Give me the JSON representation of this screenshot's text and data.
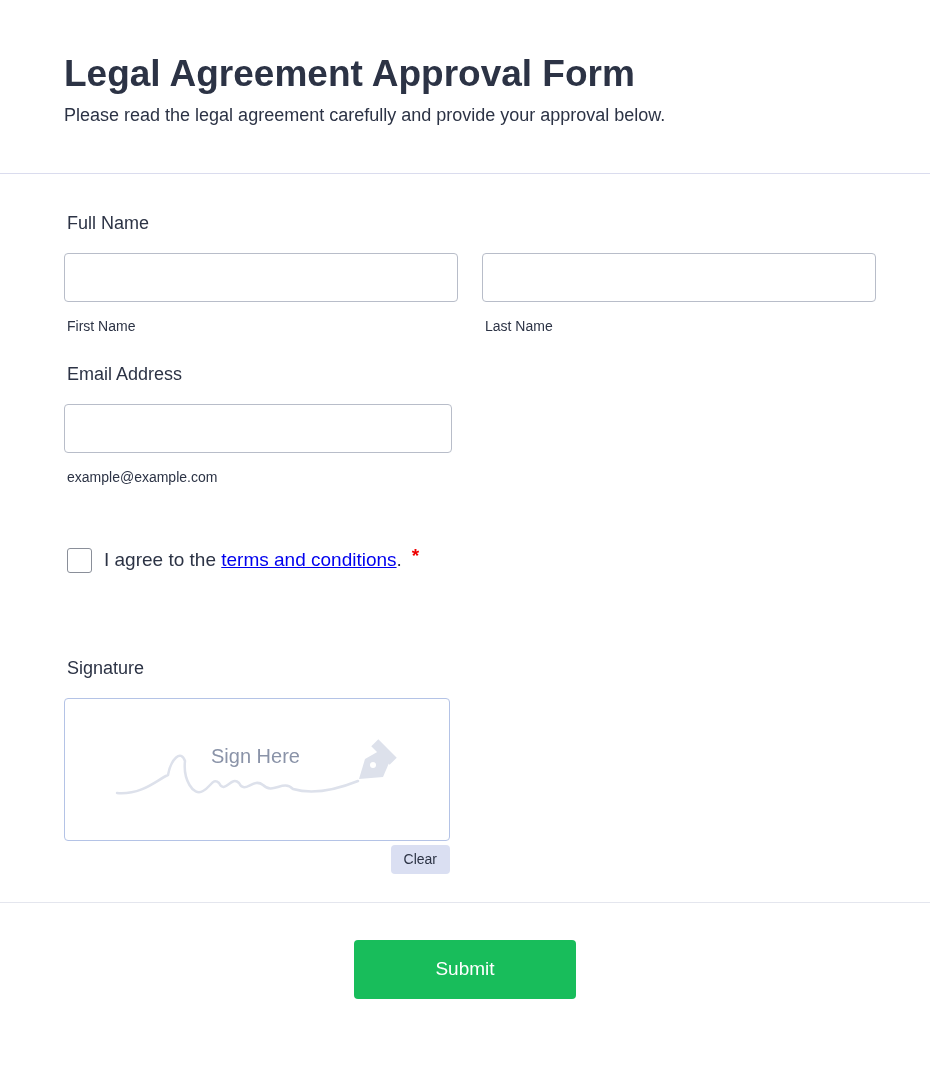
{
  "header": {
    "title": "Legal Agreement Approval Form",
    "description": "Please read the legal agreement carefully and provide your approval below."
  },
  "full_name": {
    "label": "Full Name",
    "fields": [
      {
        "sublabel": "First Name"
      },
      {
        "sublabel": "Last Name"
      }
    ]
  },
  "email": {
    "label": "Email Address",
    "sublabel": "example@example.com"
  },
  "agreement": {
    "prefix": "I agree to the ",
    "link": "terms and conditions",
    "suffix": ".",
    "required_mark": "*",
    "checked": false
  },
  "signature": {
    "label": "Signature",
    "placeholder": "Sign Here",
    "clear_button": "Clear"
  },
  "submit_button": "Submit"
}
